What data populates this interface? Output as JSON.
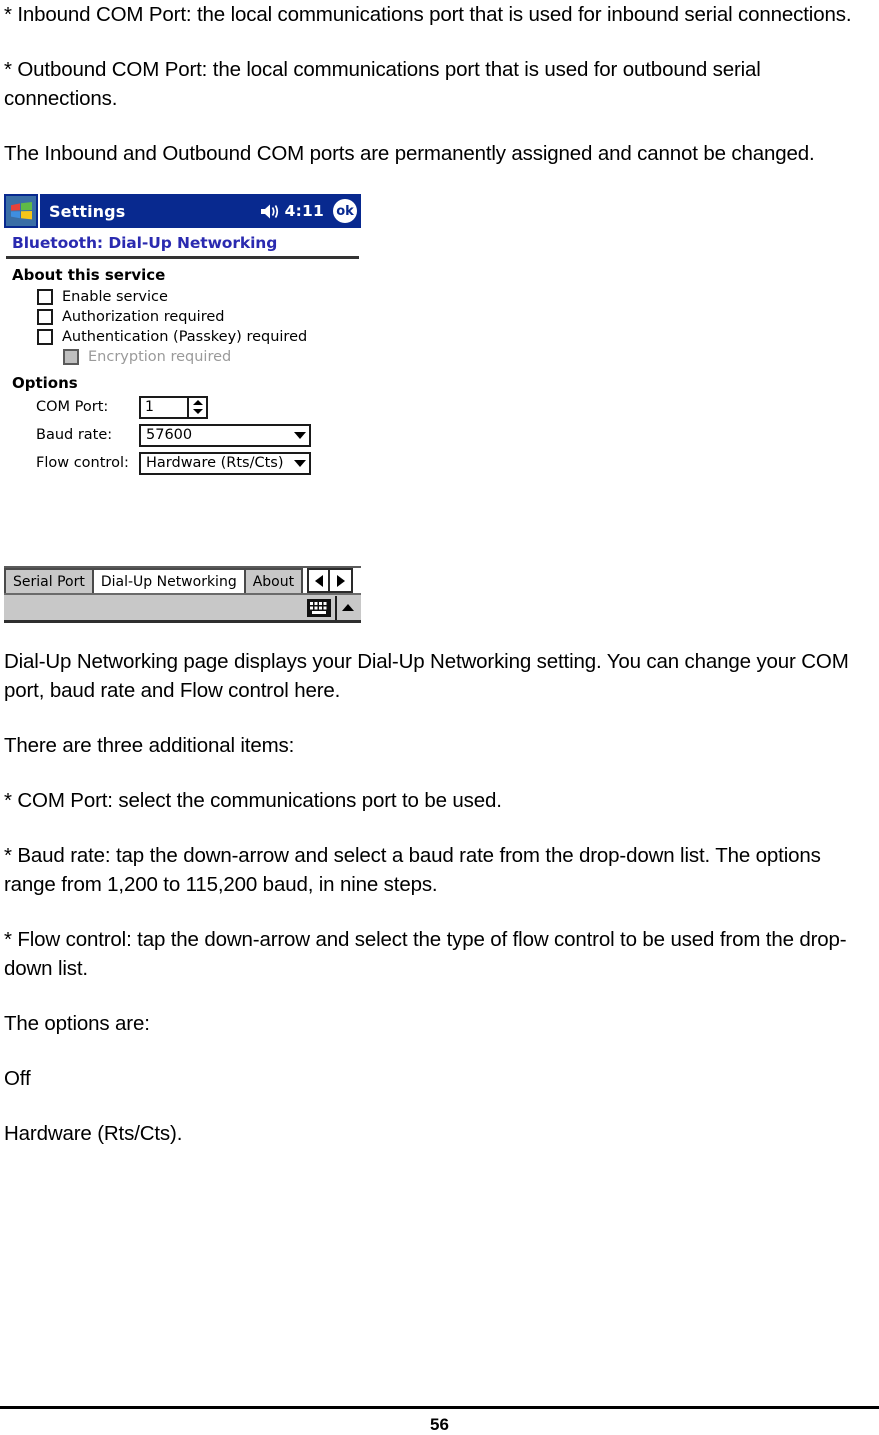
{
  "document": {
    "paragraphs": [
      "* Inbound COM Port: the local communications port that is used for inbound serial connections.",
      "* Outbound COM Port: the local communications port that is used for outbound serial connections.",
      "The Inbound and Outbound COM ports are permanently assigned and cannot be changed."
    ],
    "paragraphs_after": [
      "Dial-Up Networking page displays your Dial-Up Networking setting. You can change your COM port, baud rate and Flow control here.",
      "There are three additional items:",
      "* COM Port: select the communications port to be used.",
      "* Baud rate: tap the down-arrow and select a baud rate from the drop-down list. The options range from 1,200 to 115,200 baud, in nine steps.",
      "* Flow control: tap the down-arrow and select the type of flow control to be used from the drop-down list.",
      "The options are:",
      "Off",
      "Hardware (Rts/Cts)."
    ],
    "footer": {
      "page_number": "56"
    }
  },
  "pda_screenshot": {
    "titlebar": {
      "start_icon": "windows-flag-icon",
      "title": "Settings",
      "volume_icon": "speaker-icon",
      "clock": "4:11",
      "ok_label": "ok",
      "background_color": "#08298f"
    },
    "heading": "Bluetooth: Dial-Up Networking",
    "heading_color": "#2a2ab0",
    "about_section": {
      "title": "About this service",
      "checkboxes": [
        {
          "label": "Enable service",
          "checked": false,
          "disabled": false,
          "indented": false
        },
        {
          "label": "Authorization required",
          "checked": false,
          "disabled": false,
          "indented": false
        },
        {
          "label": "Authentication (Passkey) required",
          "checked": false,
          "disabled": false,
          "indented": false
        },
        {
          "label": "Encryption required",
          "checked": false,
          "disabled": true,
          "indented": true
        }
      ]
    },
    "options_section": {
      "title": "Options",
      "com_port": {
        "label": "COM Port:",
        "value": "1"
      },
      "baud_rate": {
        "label": "Baud rate:",
        "value": "57600"
      },
      "flow_control": {
        "label": "Flow control:",
        "value": "Hardware (Rts/Cts)"
      }
    },
    "tabs": [
      {
        "label": "Serial Port",
        "active": false
      },
      {
        "label": "Dial-Up Networking",
        "active": true
      },
      {
        "label": "About",
        "active": false
      }
    ],
    "tab_nav": {
      "prev_icon": "arrow-left-icon",
      "next_icon": "arrow-right-icon"
    },
    "sip_bar": {
      "keyboard_icon": "keyboard-icon",
      "expand_icon": "chevron-up-icon"
    }
  }
}
